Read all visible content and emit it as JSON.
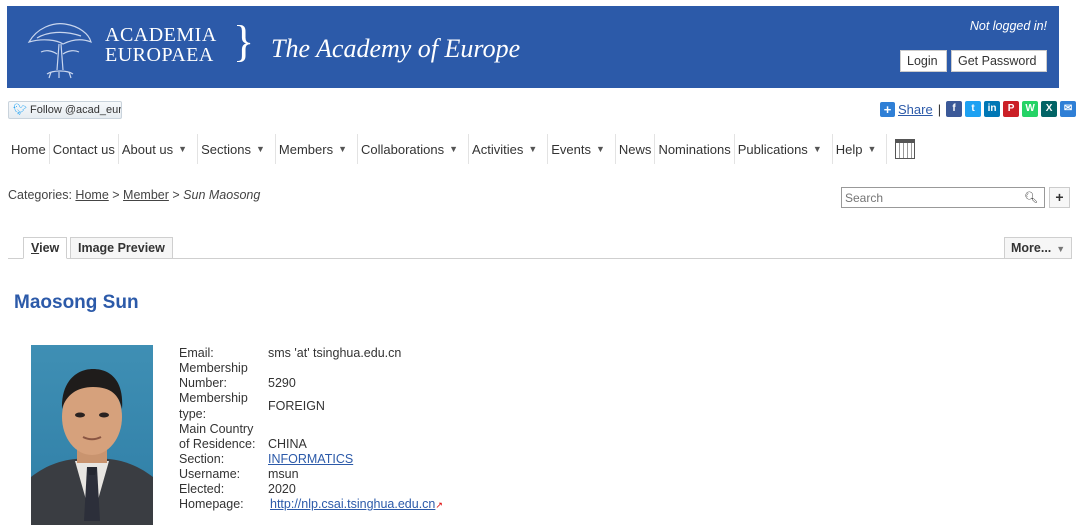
{
  "header": {
    "logo_line1": "ACADEMIA",
    "logo_line2": "EUROPAEA",
    "logo_brace": "}",
    "tagline": "The Academy of Europe",
    "login_status": "Not logged in!",
    "login_label": "Login",
    "get_password_label": "Get Password",
    "banner_color": "#2c5aa9"
  },
  "social": {
    "follow_label": "Follow @acad_eur",
    "share_label": "Share",
    "icons": [
      {
        "name": "facebook-icon",
        "glyph": "f",
        "color": "#3b5998"
      },
      {
        "name": "twitter-icon",
        "glyph": "t",
        "color": "#1da1f2"
      },
      {
        "name": "linkedin-icon",
        "glyph": "in",
        "color": "#0077b5"
      },
      {
        "name": "pinterest-icon",
        "glyph": "P",
        "color": "#cb2027"
      },
      {
        "name": "whatsapp-icon",
        "glyph": "W",
        "color": "#25d366"
      },
      {
        "name": "xing-icon",
        "glyph": "X",
        "color": "#026466"
      },
      {
        "name": "email-icon",
        "glyph": "✉",
        "color": "#2f7fd6"
      }
    ]
  },
  "nav": {
    "items": [
      {
        "label": "Home",
        "dropdown": false
      },
      {
        "label": "Contact us",
        "dropdown": false
      },
      {
        "label": "About us",
        "dropdown": true
      },
      {
        "label": "Sections",
        "dropdown": true
      },
      {
        "label": "Members",
        "dropdown": true
      },
      {
        "label": "Collaborations",
        "dropdown": true
      },
      {
        "label": "Activities",
        "dropdown": true
      },
      {
        "label": "Events",
        "dropdown": true
      },
      {
        "label": "News",
        "dropdown": false
      },
      {
        "label": "Nominations",
        "dropdown": false
      },
      {
        "label": "Publications",
        "dropdown": true
      },
      {
        "label": "Help",
        "dropdown": true
      }
    ],
    "calendar_icon": "calendar-icon"
  },
  "breadcrumb": {
    "prefix": "Categories:",
    "home": "Home",
    "member": "Member",
    "separator": ">",
    "current": "Sun Maosong"
  },
  "search": {
    "placeholder": "Search"
  },
  "tabs": {
    "view_first": "V",
    "view_rest": "iew",
    "image_preview": "Image Preview",
    "more": "More..."
  },
  "person": {
    "title": "Maosong Sun",
    "fields": {
      "email_label": "Email:",
      "email_value": "sms 'at' tsinghua.edu.cn",
      "membership_label_1": "Membership",
      "membership_label_2": "Number:",
      "membership_value": "5290",
      "type_label_1": "Membership",
      "type_label_2": "type:",
      "type_value": "FOREIGN",
      "residence_label_1": "Main Country",
      "residence_label_2": "of Residence:",
      "residence_value": "CHINA",
      "section_label": "Section:",
      "section_value": "INFORMATICS",
      "username_label": "Username:",
      "username_value": "msun",
      "elected_label": "Elected:",
      "elected_value": "2020",
      "homepage_label": "Homepage:",
      "homepage_value": "http://nlp.csai.tsinghua.edu.cn"
    }
  }
}
